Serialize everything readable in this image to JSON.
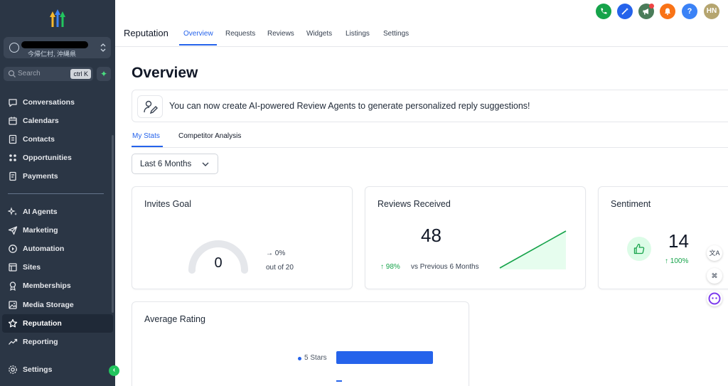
{
  "colors": {
    "sidebar_bg": "#2b3645",
    "accent": "#2563eb",
    "success": "#16a34a"
  },
  "sidebar": {
    "location_subtitle": "今帰仁村, 沖縄県",
    "search": {
      "placeholder": "Search",
      "shortcut": "ctrl K"
    },
    "nav_primary": [
      {
        "label": "Conversations",
        "icon": "chat-bubble-icon"
      },
      {
        "label": "Calendars",
        "icon": "calendar-icon"
      },
      {
        "label": "Contacts",
        "icon": "contacts-icon"
      },
      {
        "label": "Opportunities",
        "icon": "opportunities-icon"
      },
      {
        "label": "Payments",
        "icon": "payments-icon"
      }
    ],
    "nav_secondary": [
      {
        "label": "AI Agents",
        "icon": "sparkle-icon"
      },
      {
        "label": "Marketing",
        "icon": "send-icon"
      },
      {
        "label": "Automation",
        "icon": "automation-icon"
      },
      {
        "label": "Sites",
        "icon": "sites-icon"
      },
      {
        "label": "Memberships",
        "icon": "badge-icon"
      },
      {
        "label": "Media Storage",
        "icon": "image-icon"
      },
      {
        "label": "Reputation",
        "icon": "star-icon",
        "active": true
      },
      {
        "label": "Reporting",
        "icon": "trend-icon"
      }
    ],
    "settings_label": "Settings"
  },
  "header": {
    "title": "Reputation",
    "tabs": [
      "Overview",
      "Requests",
      "Reviews",
      "Widgets",
      "Listings",
      "Settings"
    ],
    "active_tab": "Overview",
    "user_initials": "HN",
    "help_label": "?"
  },
  "main": {
    "title": "Overview",
    "banner_text": "You can now create AI-powered Review Agents to generate personalized reply suggestions!",
    "subtabs": [
      "My Stats",
      "Competitor Analysis"
    ],
    "active_subtab": "My Stats",
    "range_select": "Last 6 Months",
    "invites_goal": {
      "title": "Invites Goal",
      "value": "0",
      "change": "0%",
      "target_text": "out of 20",
      "progress": 0
    },
    "reviews_received": {
      "title": "Reviews Received",
      "value": "48",
      "change": "98%",
      "comparison": "vs Previous 6 Months"
    },
    "sentiment": {
      "title": "Sentiment",
      "value": "14",
      "change": "100%"
    },
    "average_rating": {
      "title": "Average Rating",
      "rows": [
        {
          "label": "5 Stars",
          "fraction": 0.68
        }
      ]
    }
  },
  "side_widgets": {
    "translate_label": "文A"
  }
}
